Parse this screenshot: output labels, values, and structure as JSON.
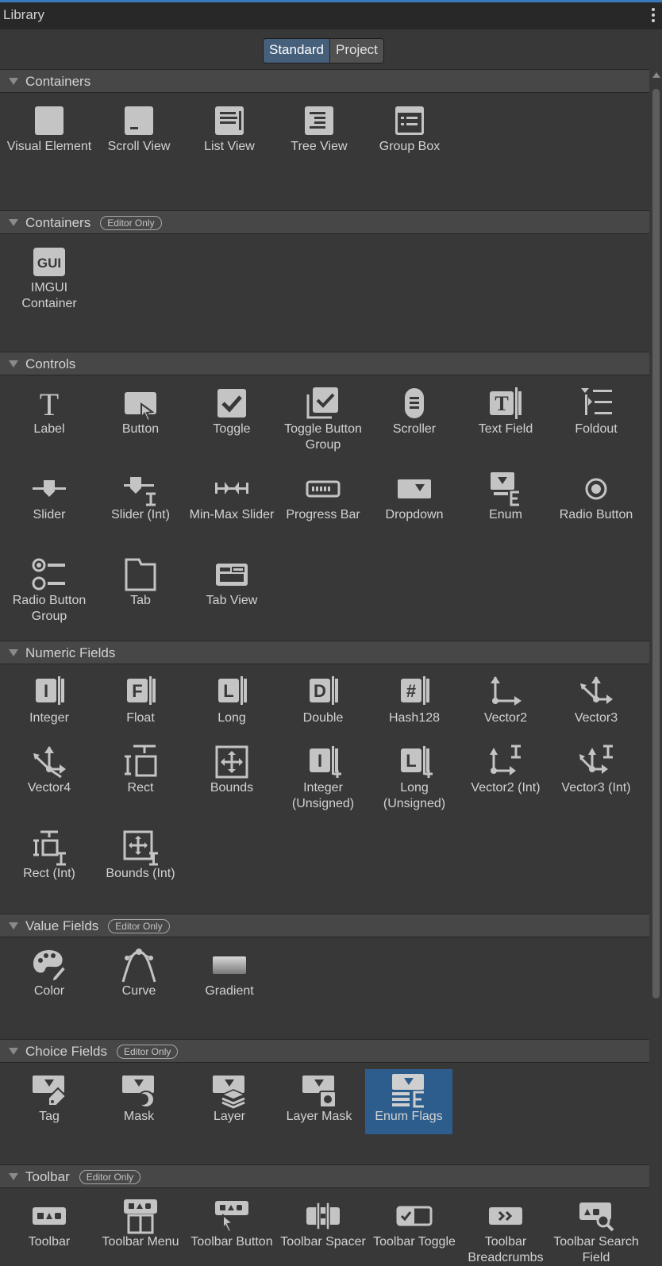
{
  "window": {
    "title": "Library",
    "menu_icon": "kebab-menu-icon"
  },
  "toggle": {
    "standard": "Standard",
    "project": "Project",
    "active": "Standard"
  },
  "sections": [
    {
      "label": "Containers",
      "badge": "",
      "items": [
        {
          "label": "Visual Element",
          "icon": "visual-element-icon"
        },
        {
          "label": "Scroll View",
          "icon": "scroll-view-icon"
        },
        {
          "label": "List View",
          "icon": "list-view-icon"
        },
        {
          "label": "Tree View",
          "icon": "tree-view-icon"
        },
        {
          "label": "Group Box",
          "icon": "group-box-icon"
        }
      ]
    },
    {
      "label": "Containers",
      "badge": "Editor Only",
      "items": [
        {
          "label": "IMGUI Container",
          "icon": "imgui-container-icon",
          "glyph": "GUI"
        }
      ]
    },
    {
      "label": "Controls",
      "badge": "",
      "items": [
        {
          "label": "Label",
          "icon": "label-icon",
          "glyph": "T"
        },
        {
          "label": "Button",
          "icon": "button-icon"
        },
        {
          "label": "Toggle",
          "icon": "toggle-icon"
        },
        {
          "label": "Toggle Button Group",
          "icon": "toggle-button-group-icon"
        },
        {
          "label": "Scroller",
          "icon": "scroller-icon"
        },
        {
          "label": "Text Field",
          "icon": "text-field-icon",
          "glyph": "T"
        },
        {
          "label": "Foldout",
          "icon": "foldout-icon"
        },
        {
          "label": "Slider",
          "icon": "slider-icon"
        },
        {
          "label": "Slider (Int)",
          "icon": "slider-int-icon"
        },
        {
          "label": "Min-Max Slider",
          "icon": "min-max-slider-icon"
        },
        {
          "label": "Progress Bar",
          "icon": "progress-bar-icon"
        },
        {
          "label": "Dropdown",
          "icon": "dropdown-icon"
        },
        {
          "label": "Enum",
          "icon": "enum-icon"
        },
        {
          "label": "Radio Button",
          "icon": "radio-button-icon"
        },
        {
          "label": "Radio Button Group",
          "icon": "radio-button-group-icon"
        },
        {
          "label": "Tab",
          "icon": "tab-icon"
        },
        {
          "label": "Tab View",
          "icon": "tab-view-icon"
        }
      ]
    },
    {
      "label": "Numeric Fields",
      "badge": "",
      "items": [
        {
          "label": "Integer",
          "icon": "integer-field-icon",
          "glyph": "I"
        },
        {
          "label": "Float",
          "icon": "float-field-icon",
          "glyph": "F"
        },
        {
          "label": "Long",
          "icon": "long-field-icon",
          "glyph": "L"
        },
        {
          "label": "Double",
          "icon": "double-field-icon",
          "glyph": "D"
        },
        {
          "label": "Hash128",
          "icon": "hash128-field-icon",
          "glyph": "#"
        },
        {
          "label": "Vector2",
          "icon": "vector2-field-icon"
        },
        {
          "label": "Vector3",
          "icon": "vector3-field-icon"
        },
        {
          "label": "Vector4",
          "icon": "vector4-field-icon"
        },
        {
          "label": "Rect",
          "icon": "rect-field-icon"
        },
        {
          "label": "Bounds",
          "icon": "bounds-field-icon"
        },
        {
          "label": "Integer (Unsigned)",
          "icon": "unsigned-integer-field-icon",
          "glyph": "I"
        },
        {
          "label": "Long (Unsigned)",
          "icon": "unsigned-long-field-icon",
          "glyph": "L"
        },
        {
          "label": "Vector2 (Int)",
          "icon": "vector2-int-field-icon"
        },
        {
          "label": "Vector3 (Int)",
          "icon": "vector3-int-field-icon"
        },
        {
          "label": "Rect (Int)",
          "icon": "rect-int-field-icon"
        },
        {
          "label": "Bounds (Int)",
          "icon": "bounds-int-field-icon"
        }
      ]
    },
    {
      "label": "Value Fields",
      "badge": "Editor Only",
      "items": [
        {
          "label": "Color",
          "icon": "color-palette-icon"
        },
        {
          "label": "Curve",
          "icon": "curve-icon"
        },
        {
          "label": "Gradient",
          "icon": "gradient-icon"
        }
      ]
    },
    {
      "label": "Choice Fields",
      "badge": "Editor Only",
      "items": [
        {
          "label": "Tag",
          "icon": "tag-field-icon"
        },
        {
          "label": "Mask",
          "icon": "mask-field-icon"
        },
        {
          "label": "Layer",
          "icon": "layer-field-icon"
        },
        {
          "label": "Layer Mask",
          "icon": "layer-mask-field-icon"
        },
        {
          "label": "Enum Flags",
          "icon": "enum-flags-field-icon",
          "selected": true
        }
      ]
    },
    {
      "label": "Toolbar",
      "badge": "Editor Only",
      "items": [
        {
          "label": "Toolbar",
          "icon": "toolbar-icon"
        },
        {
          "label": "Toolbar Menu",
          "icon": "toolbar-menu-icon"
        },
        {
          "label": "Toolbar Button",
          "icon": "toolbar-button-icon"
        },
        {
          "label": "Toolbar Spacer",
          "icon": "toolbar-spacer-icon"
        },
        {
          "label": "Toolbar Toggle",
          "icon": "toolbar-toggle-icon"
        },
        {
          "label": "Toolbar Breadcrumbs",
          "icon": "toolbar-breadcrumbs-icon"
        },
        {
          "label": "Toolbar Search Field",
          "icon": "toolbar-search-field-icon"
        }
      ]
    }
  ],
  "colors": {
    "accent": "#3a79bb",
    "selected": "#2d5d8c",
    "icon": "#c4c4c4",
    "background": "#383838"
  }
}
